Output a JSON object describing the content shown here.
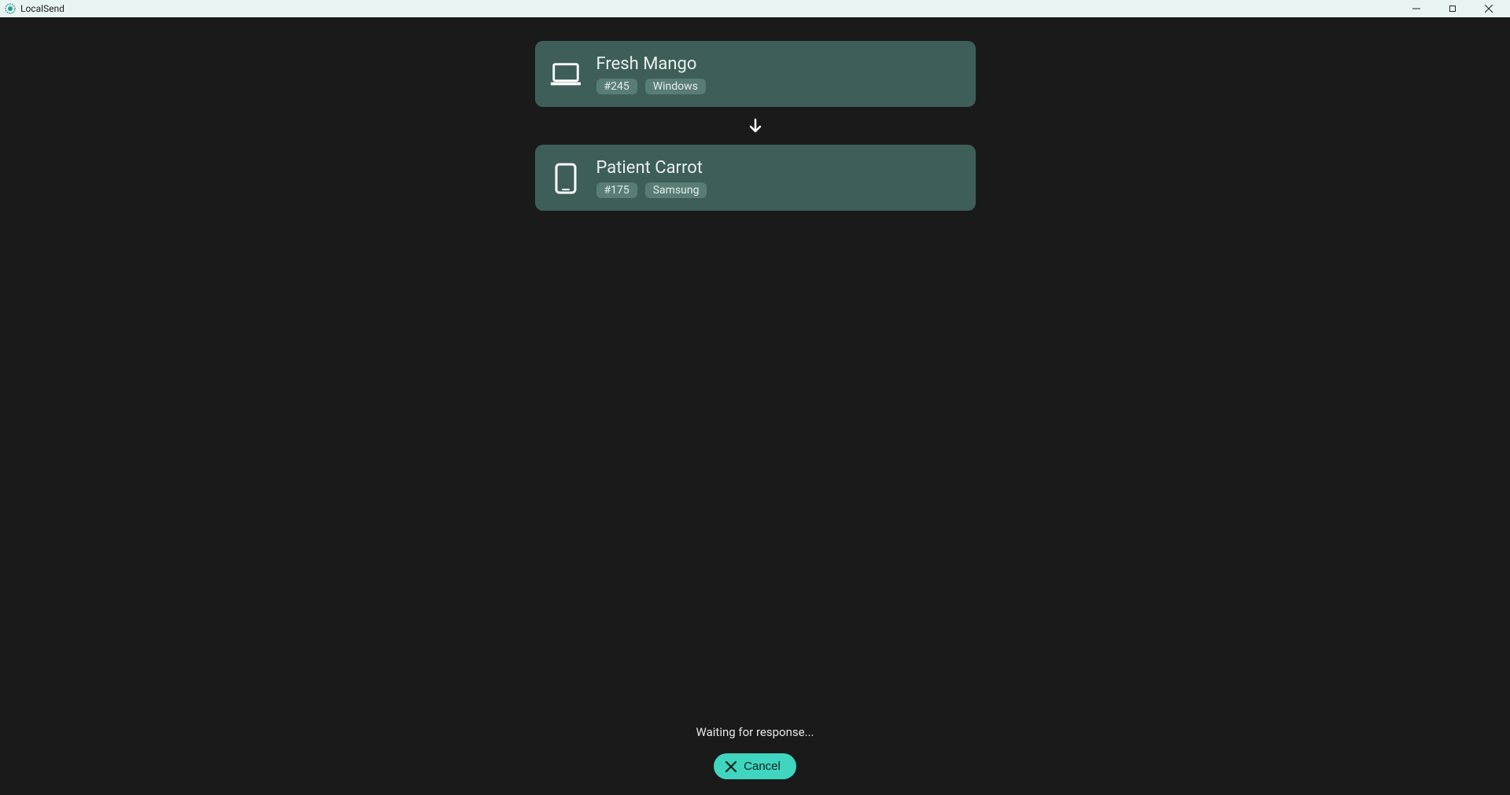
{
  "window": {
    "title": "LocalSend"
  },
  "sender": {
    "name": "Fresh Mango",
    "tag_id": "#245",
    "tag_platform": "Windows",
    "device_type": "laptop"
  },
  "receiver": {
    "name": "Patient Carrot",
    "tag_id": "#175",
    "tag_platform": "Samsung",
    "device_type": "phone"
  },
  "status": {
    "text": "Waiting for response..."
  },
  "actions": {
    "cancel_label": "Cancel"
  },
  "colors": {
    "card_bg": "#3e5e59",
    "tag_bg": "#597d76",
    "accent": "#3fd5bf",
    "app_bg": "#1a1a1a"
  }
}
